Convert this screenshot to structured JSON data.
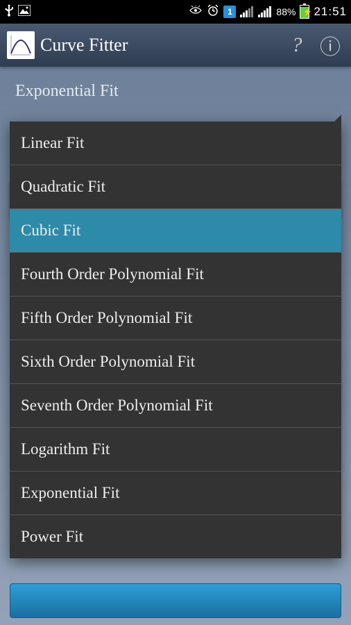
{
  "status": {
    "time": "21:51",
    "battery_pct": "88%",
    "sim_badge": "1"
  },
  "appbar": {
    "title": "Curve Fitter",
    "help_glyph": "?",
    "info_glyph": "ⓘ"
  },
  "spinner": {
    "selected": "Exponential Fit"
  },
  "dropdown": {
    "selected_index": 2,
    "items": [
      "Linear Fit",
      "Quadratic Fit",
      "Cubic Fit",
      "Fourth Order Polynomial Fit",
      "Fifth Order Polynomial Fit",
      "Sixth Order Polynomial Fit",
      "Seventh Order Polynomial Fit",
      "Logarithm Fit",
      "Exponential Fit",
      "Power Fit"
    ]
  }
}
